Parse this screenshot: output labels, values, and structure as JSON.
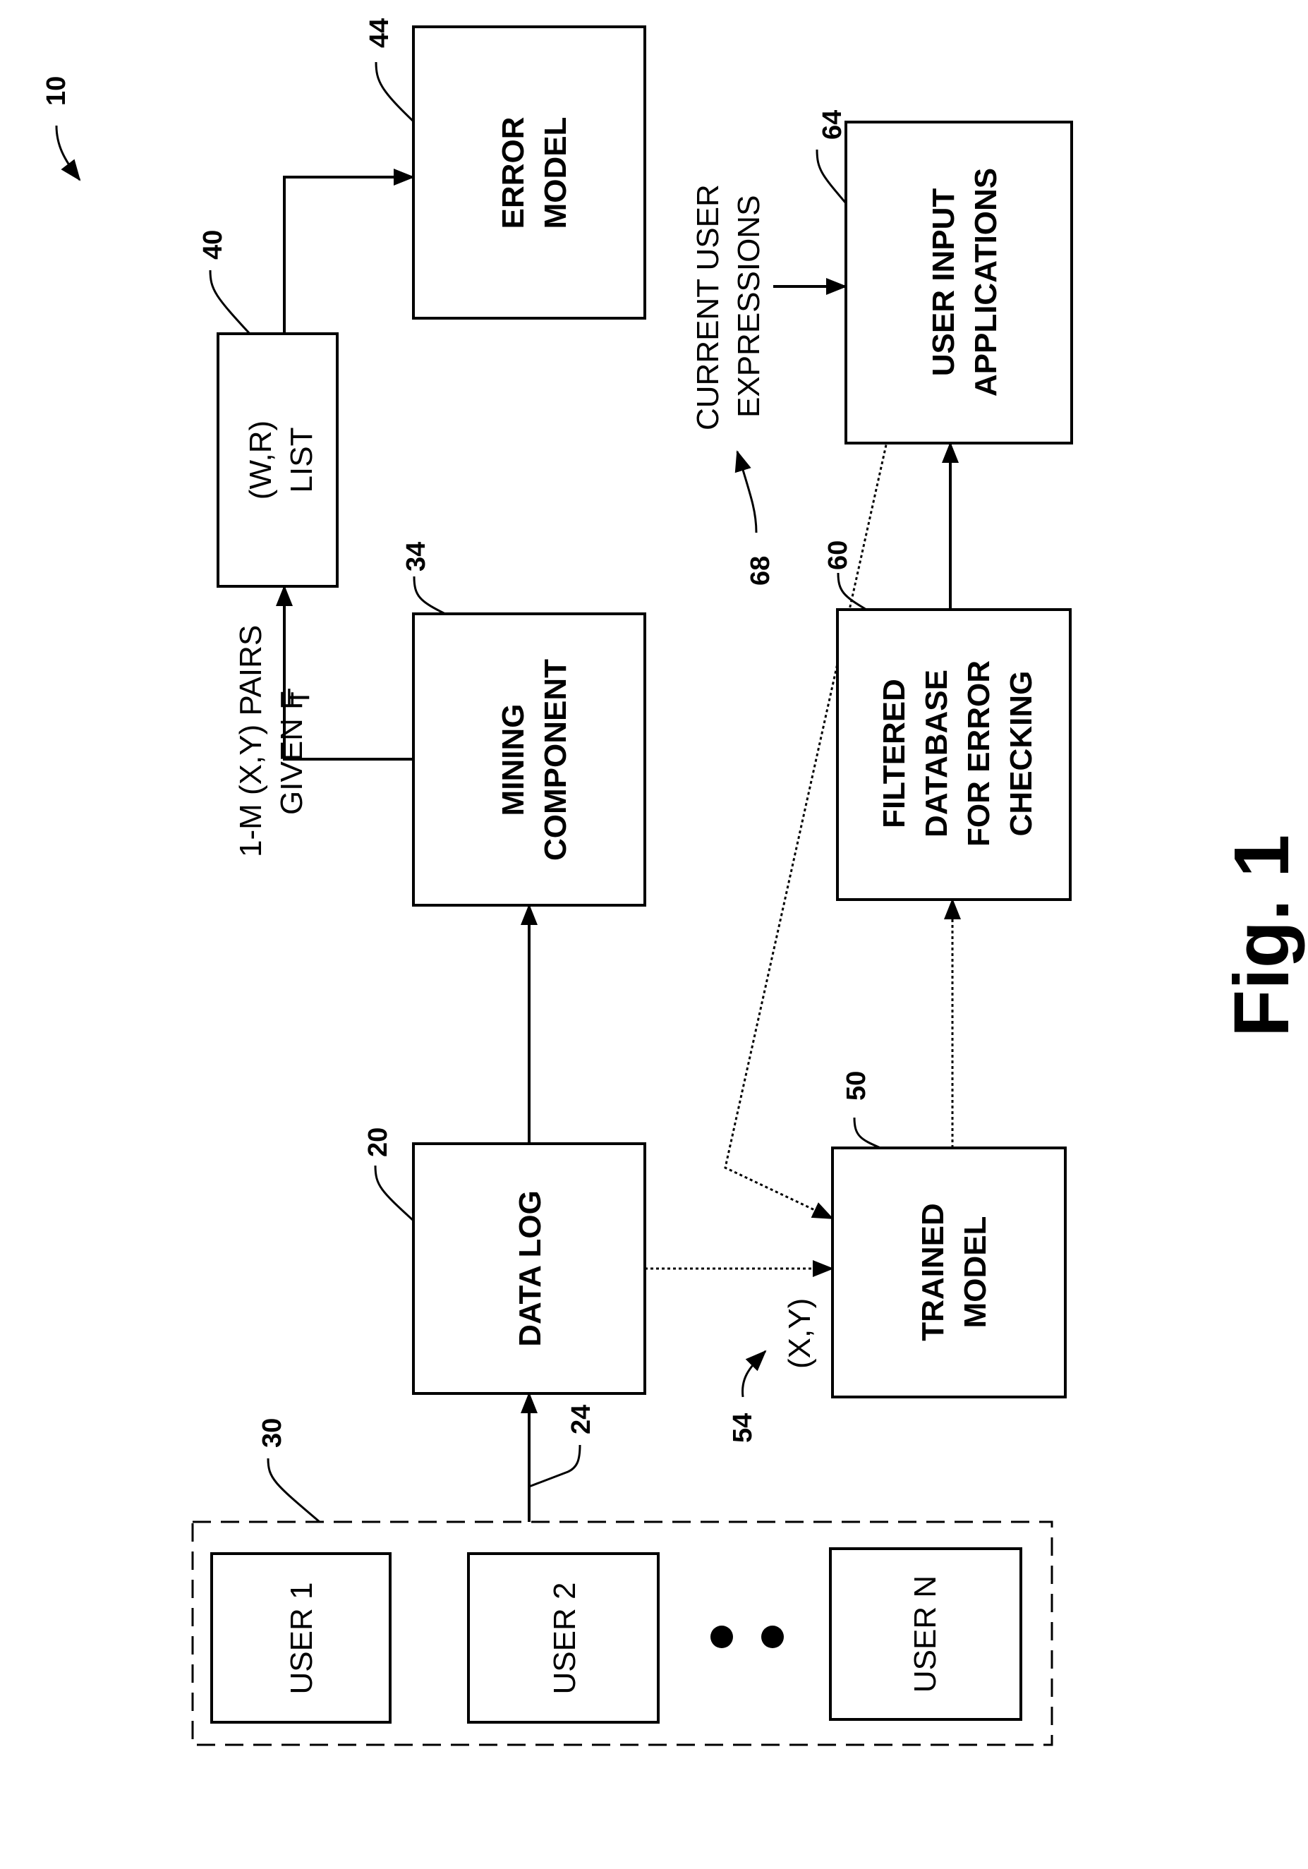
{
  "figure": {
    "label": "Fig. 1",
    "ref": "10"
  },
  "blocks": {
    "error_model": {
      "ref": "44",
      "lines": [
        "ERROR",
        "MODEL"
      ]
    },
    "wr_list": {
      "ref": "40",
      "lines": [
        "(W,R)",
        "LIST"
      ]
    },
    "mining": {
      "ref": "34",
      "lines": [
        "MINING",
        "COMPONENT"
      ]
    },
    "data_log": {
      "ref": "20",
      "lines": [
        "DATA LOG"
      ]
    },
    "trained_model": {
      "ref": "50",
      "lines": [
        "TRAINED",
        "MODEL"
      ]
    },
    "filtered_db": {
      "ref": "60",
      "lines": [
        "FILTERED",
        "DATABASE",
        "FOR ERROR",
        "CHECKING"
      ]
    },
    "user_input_apps": {
      "ref": "64",
      "lines": [
        "USER INPUT",
        "APPLICATIONS"
      ]
    },
    "users_group": {
      "ref": "30",
      "users": [
        "USER 1",
        "USER 2",
        "USER N"
      ]
    }
  },
  "labels": {
    "pairs": [
      "1-M (X,Y) PAIRS",
      "GIVEN F"
    ],
    "pairs_sub": "T",
    "current": [
      "CURRENT USER",
      "EXPRESSIONS"
    ],
    "current_ref": "68",
    "xy": "(X,Y)",
    "xy_ref": "54",
    "link_ref": "24"
  }
}
